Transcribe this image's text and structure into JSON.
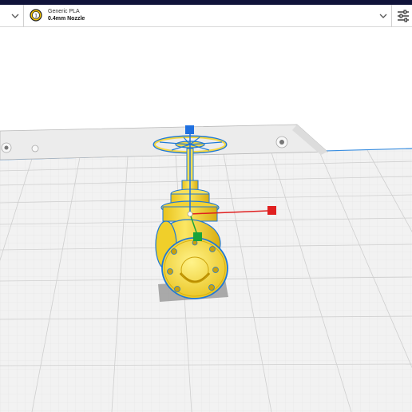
{
  "header": {
    "material": {
      "name": "Generic PLA",
      "nozzle": "0.4mm Nozzle",
      "extruder_index": "1",
      "accent_color": "#f5c400"
    },
    "icons": {
      "left_dropdown": "chevron-down-icon",
      "material_dropdown": "chevron-down-icon",
      "settings": "sliders-icon"
    },
    "colors": {
      "top_strip": "#10133a"
    }
  },
  "scene": {
    "build_plate_color": "#f0f0f0",
    "grid_color": "#d6d6d6",
    "model_color": "#f7dd3a",
    "selection_outline_color": "#1e78d6",
    "gizmo": {
      "x_axis_color": "#e02020",
      "y_axis_color": "#1aa33a",
      "z_axis_color": "#1e6fe0"
    }
  }
}
